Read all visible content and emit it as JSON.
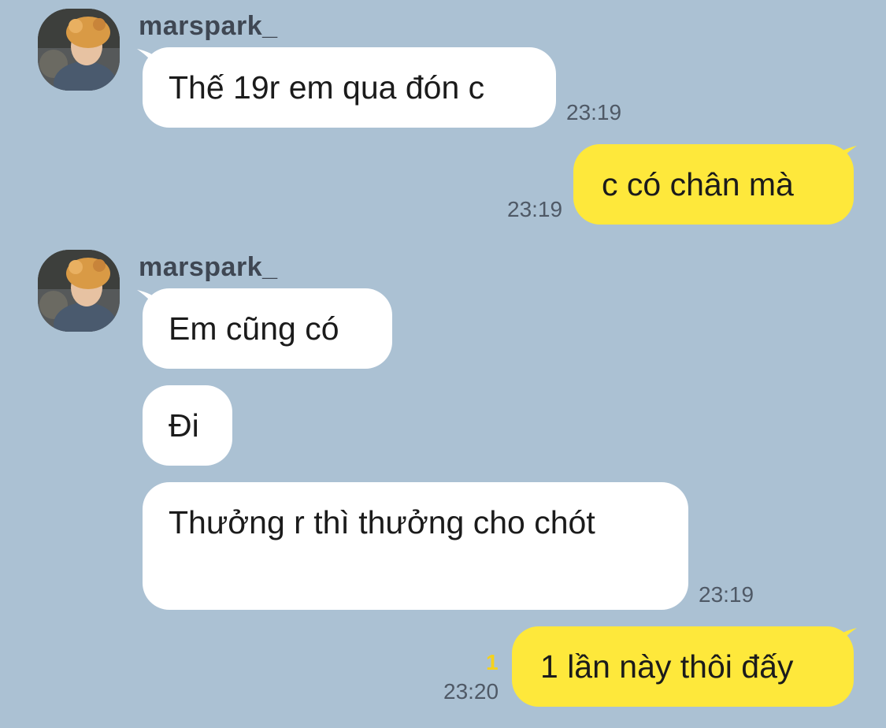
{
  "colors": {
    "background": "#abc1d3",
    "incoming_bubble": "#ffffff",
    "outgoing_bubble": "#fee83b",
    "unread_indicator": "#f5d21c"
  },
  "messages": [
    {
      "sender": "marspark_",
      "text": "Thế 19r em qua đón c",
      "time": "23:19",
      "direction": "incoming"
    },
    {
      "text": "c có chân mà",
      "time": "23:19",
      "direction": "outgoing"
    },
    {
      "sender": "marspark_",
      "text": "Em cũng có",
      "direction": "incoming"
    },
    {
      "text": "Đi",
      "direction": "incoming"
    },
    {
      "text": "Thưởng r thì thưởng cho chót",
      "time": "23:19",
      "direction": "incoming"
    },
    {
      "text": "1 lần này thôi đấy",
      "time": "23:20",
      "unread_count": "1",
      "direction": "outgoing"
    }
  ]
}
